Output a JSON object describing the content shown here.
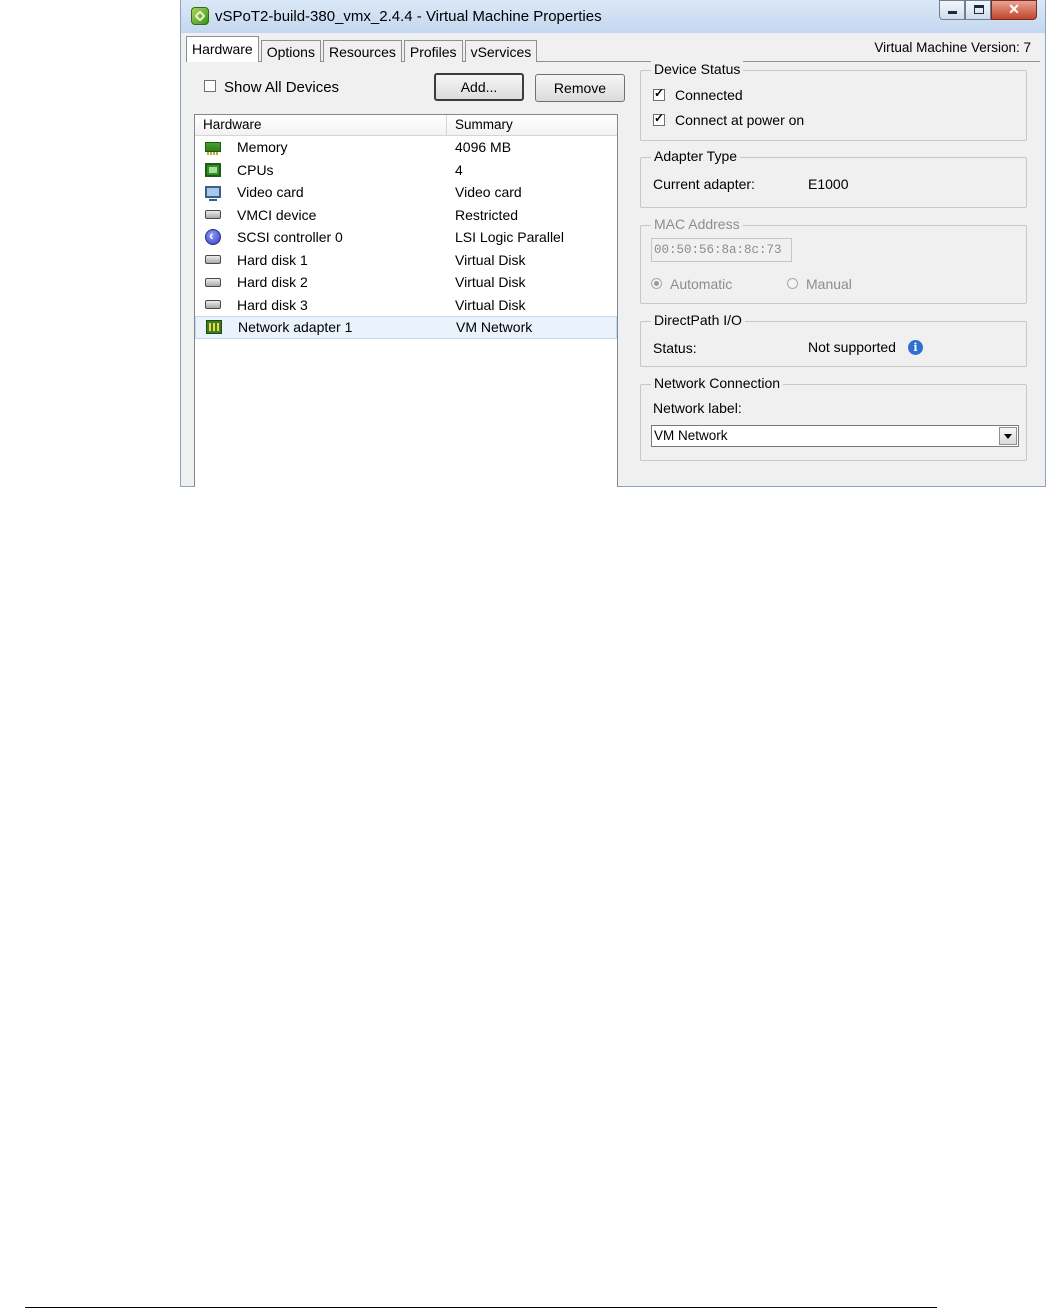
{
  "window": {
    "title": "vSPoT2-build-380_vmx_2.4.4 - Virtual Machine Properties",
    "app_icon": "vsphere-icon",
    "controls": [
      "minimize",
      "maximize",
      "close"
    ]
  },
  "tabs": [
    {
      "label": "Hardware",
      "active": true
    },
    {
      "label": "Options",
      "active": false
    },
    {
      "label": "Resources",
      "active": false
    },
    {
      "label": "Profiles",
      "active": false
    },
    {
      "label": "vServices",
      "active": false
    }
  ],
  "vm_version": "Virtual Machine Version: 7",
  "hardware_panel": {
    "show_all_label": "Show All Devices",
    "show_all_checked": false,
    "add_label": "Add...",
    "remove_label": "Remove",
    "columns": [
      "Hardware",
      "Summary"
    ],
    "rows": [
      {
        "name": "Memory",
        "summary": "4096 MB",
        "icon": "memory-icon"
      },
      {
        "name": "CPUs",
        "summary": "4",
        "icon": "cpu-icon"
      },
      {
        "name": "Video card",
        "summary": "Video card",
        "icon": "video-card-icon"
      },
      {
        "name": "VMCI device",
        "summary": "Restricted",
        "icon": "vmci-device-icon"
      },
      {
        "name": "SCSI controller 0",
        "summary": "LSI Logic Parallel",
        "icon": "scsi-controller-icon"
      },
      {
        "name": "Hard disk 1",
        "summary": "Virtual Disk",
        "icon": "hard-disk-icon"
      },
      {
        "name": "Hard disk 2",
        "summary": "Virtual Disk",
        "icon": "hard-disk-icon"
      },
      {
        "name": "Hard disk 3",
        "summary": "Virtual Disk",
        "icon": "hard-disk-icon"
      },
      {
        "name": "Network adapter 1",
        "summary": "VM Network",
        "icon": "network-adapter-icon",
        "selected": true
      }
    ]
  },
  "device_status": {
    "legend": "Device Status",
    "connected_label": "Connected",
    "connected_checked": true,
    "connect_power_label": "Connect at power on",
    "connect_power_checked": true
  },
  "adapter_type": {
    "legend": "Adapter Type",
    "label": "Current adapter:",
    "value": "E1000"
  },
  "mac_address": {
    "legend": "MAC Address",
    "value": "00:50:56:8a:8c:73",
    "automatic_label": "Automatic",
    "manual_label": "Manual",
    "selected": "Automatic"
  },
  "directpath": {
    "legend": "DirectPath I/O",
    "label": "Status:",
    "value": "Not supported",
    "info_icon": "info-icon"
  },
  "network_connection": {
    "legend": "Network Connection",
    "label": "Network label:",
    "selected": "VM Network"
  }
}
